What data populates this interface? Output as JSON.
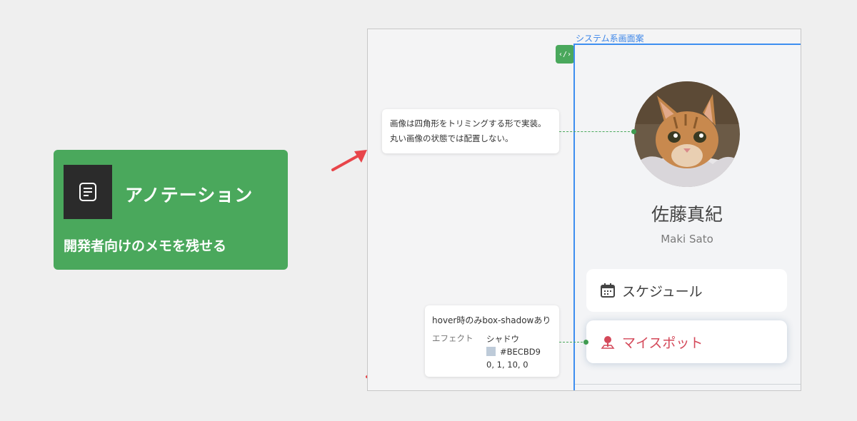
{
  "feature": {
    "icon": "document-lines-icon",
    "title": "アノテーション",
    "subtitle": "開発者向けのメモを残せる"
  },
  "canvas": {
    "frame_label": "システム系画面案",
    "code_badge": "‹/›",
    "profile": {
      "avatar": "cat-photo",
      "name": "佐藤真紀",
      "romaji": "Maki Sato"
    },
    "menu": [
      {
        "label": "スケジュール",
        "icon": "calendar-icon"
      },
      {
        "label": "マイスポット",
        "icon": "map-pin-icon",
        "color": "#d4495a"
      }
    ],
    "notes": [
      {
        "text": "画像は四角形をトリミングする形で実装。丸い画像の状態では配置しない。"
      },
      {
        "title": "hover時のみbox-shadowあり",
        "key": "エフェクト",
        "effect": "シャドウ",
        "color_hex": "#BECBD9",
        "params": "0, 1, 10, 0"
      }
    ]
  },
  "colors": {
    "accent_green": "#4aa85c",
    "frame_blue": "#3d8ef0",
    "arrow_red": "#e8454a",
    "myspot_red": "#d4495a",
    "shadow": "#BECBD9"
  }
}
